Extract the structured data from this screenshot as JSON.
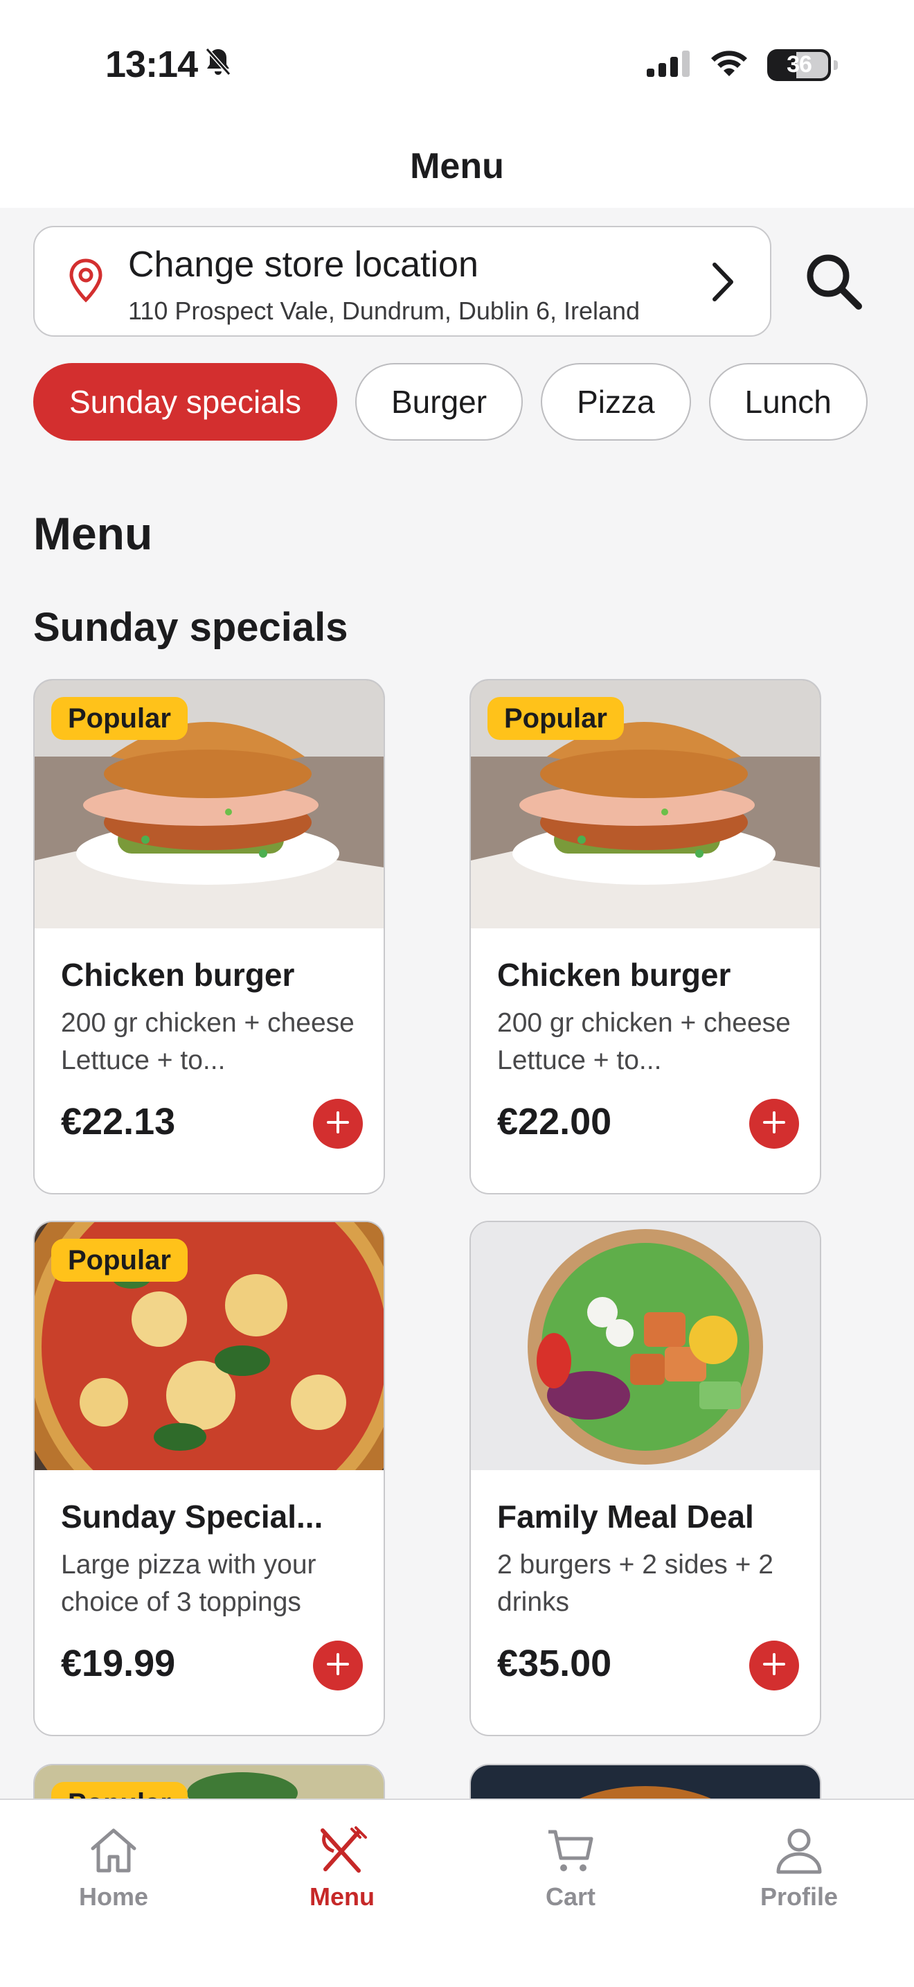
{
  "status_bar": {
    "time": "13:14",
    "battery": "36",
    "icons": [
      "bell-slash-icon",
      "signal-icon",
      "wifi-icon",
      "battery-icon"
    ]
  },
  "nav": {
    "title": "Menu"
  },
  "store": {
    "title": "Change store location",
    "address": "110 Prospect Vale, Dundrum, Dublin 6, Ireland"
  },
  "categories": [
    {
      "label": "Sunday specials",
      "active": true
    },
    {
      "label": "Burger",
      "active": false
    },
    {
      "label": "Pizza",
      "active": false
    },
    {
      "label": "Lunch",
      "active": false
    }
  ],
  "menu_heading": "Menu",
  "section_heading": "Sunday specials",
  "items": [
    {
      "badge": "Popular",
      "title": "Chicken burger",
      "description": "200 gr chicken + cheese  Lettuce + to...",
      "price": "€22.13"
    },
    {
      "badge": "Popular",
      "title": "Chicken burger",
      "description": "200 gr chicken + cheese  Lettuce + to...",
      "price": "€22.00"
    },
    {
      "badge": "Popular",
      "title": "Sunday Special...",
      "description": "Large pizza with your choice of 3 toppings",
      "price": "€19.99"
    },
    {
      "badge": "",
      "title": "Family Meal Deal",
      "description": "2 burgers + 2 sides + 2 drinks",
      "price": "€35.00"
    }
  ],
  "peek_badge": "Popular",
  "tabs": [
    {
      "label": "Home",
      "icon": "home-icon"
    },
    {
      "label": "Menu",
      "icon": "fork-knife-icon",
      "active": true
    },
    {
      "label": "Cart",
      "icon": "cart-icon"
    },
    {
      "label": "Profile",
      "icon": "person-icon"
    }
  ],
  "colors": {
    "accent": "#d32f2f",
    "badge": "#ffc21a"
  }
}
